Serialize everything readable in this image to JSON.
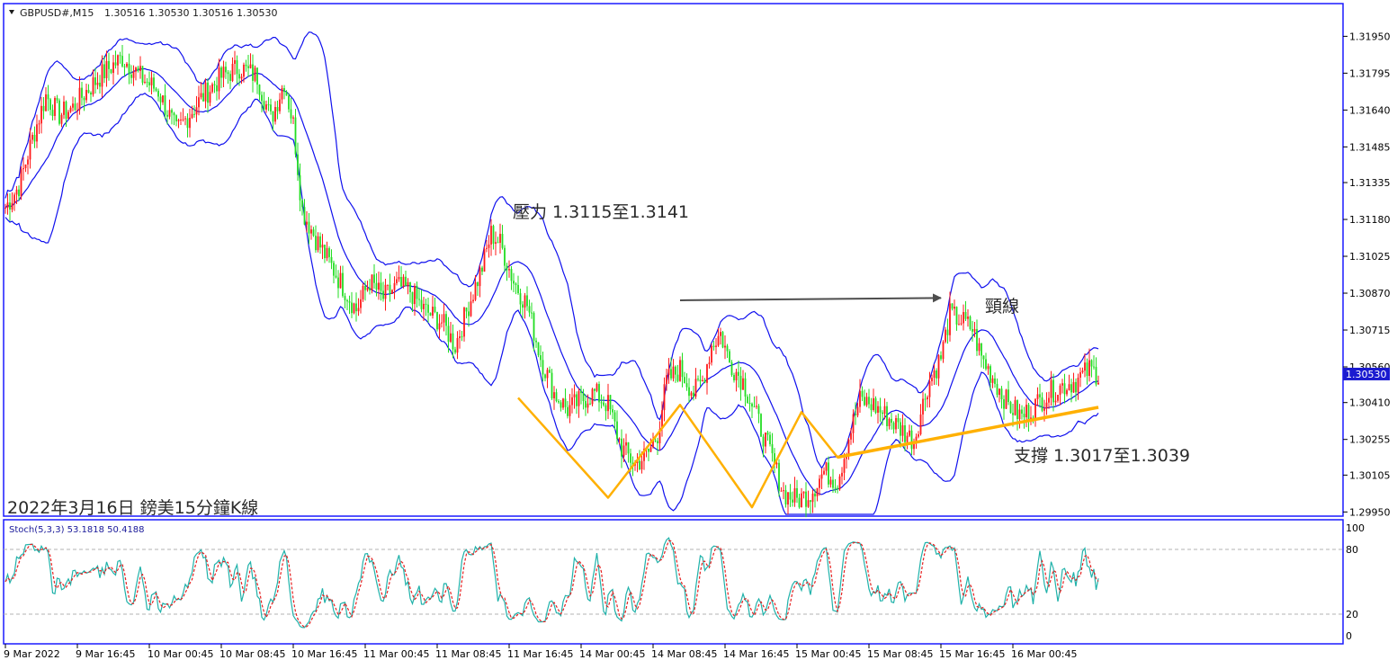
{
  "chart_data": {
    "type": "candlestick",
    "header": {
      "symbol": "GBPUSD#,M15",
      "ohlc": "1.30516 1.30530 1.30516 1.30530"
    },
    "overlay_title": "2022年3月16日 鎊美15分鐘K線",
    "price_axis": {
      "ylim": [
        1.2994,
        1.3208
      ],
      "ticks": [
        "1.31950",
        "1.31795",
        "1.31640",
        "1.31485",
        "1.31335",
        "1.31180",
        "1.31025",
        "1.30870",
        "1.30715",
        "1.30560",
        "1.30410",
        "1.30255",
        "1.30105",
        "1.29950"
      ],
      "tick_values": [
        1.3195,
        1.31795,
        1.3164,
        1.31485,
        1.31335,
        1.3118,
        1.31025,
        1.3087,
        1.30715,
        1.3056,
        1.3041,
        1.30255,
        1.30105,
        1.2995
      ],
      "current_price": "1.30530",
      "current_value": 1.3053
    },
    "time_axis": {
      "labels": [
        "9 Mar 2022",
        "9 Mar 16:45",
        "10 Mar 00:45",
        "10 Mar 08:45",
        "10 Mar 16:45",
        "11 Mar 00:45",
        "11 Mar 08:45",
        "11 Mar 16:45",
        "14 Mar 00:45",
        "14 Mar 08:45",
        "14 Mar 16:45",
        "15 Mar 00:45",
        "15 Mar 08:45",
        "15 Mar 16:45",
        "16 Mar 00:45"
      ],
      "bar_index": [
        0,
        32,
        64,
        96,
        128,
        160,
        192,
        224,
        256,
        288,
        320,
        352,
        384,
        416,
        448
      ]
    },
    "price_path": [
      [
        0,
        1.3123
      ],
      [
        6,
        1.3132
      ],
      [
        12,
        1.3152
      ],
      [
        18,
        1.317
      ],
      [
        24,
        1.3162
      ],
      [
        30,
        1.3165
      ],
      [
        36,
        1.3172
      ],
      [
        44,
        1.318
      ],
      [
        52,
        1.3186
      ],
      [
        60,
        1.3178
      ],
      [
        68,
        1.3172
      ],
      [
        76,
        1.3155
      ],
      [
        80,
        1.316
      ],
      [
        88,
        1.317
      ],
      [
        96,
        1.3178
      ],
      [
        104,
        1.3182
      ],
      [
        112,
        1.3178
      ],
      [
        118,
        1.316
      ],
      [
        124,
        1.3176
      ],
      [
        128,
        1.3158
      ],
      [
        132,
        1.3122
      ],
      [
        138,
        1.311
      ],
      [
        144,
        1.31
      ],
      [
        150,
        1.309
      ],
      [
        156,
        1.308
      ],
      [
        162,
        1.3092
      ],
      [
        168,
        1.3085
      ],
      [
        174,
        1.309
      ],
      [
        180,
        1.3088
      ],
      [
        186,
        1.308
      ],
      [
        194,
        1.3075
      ],
      [
        200,
        1.3065
      ],
      [
        206,
        1.3082
      ],
      [
        212,
        1.3098
      ],
      [
        216,
        1.3112
      ],
      [
        220,
        1.3108
      ],
      [
        226,
        1.3092
      ],
      [
        232,
        1.3082
      ],
      [
        238,
        1.306
      ],
      [
        244,
        1.3045
      ],
      [
        250,
        1.3038
      ],
      [
        256,
        1.3042
      ],
      [
        262,
        1.3045
      ],
      [
        268,
        1.304
      ],
      [
        274,
        1.3022
      ],
      [
        280,
        1.3015
      ],
      [
        286,
        1.302
      ],
      [
        290,
        1.3028
      ],
      [
        294,
        1.305
      ],
      [
        300,
        1.3055
      ],
      [
        306,
        1.3045
      ],
      [
        310,
        1.305
      ],
      [
        314,
        1.3065
      ],
      [
        318,
        1.307
      ],
      [
        322,
        1.3058
      ],
      [
        328,
        1.305
      ],
      [
        334,
        1.3035
      ],
      [
        340,
        1.302
      ],
      [
        346,
        1.3003
      ],
      [
        352,
        1.3
      ],
      [
        358,
        1.3003
      ],
      [
        364,
        1.3012
      ],
      [
        370,
        1.3008
      ],
      [
        376,
        1.303
      ],
      [
        380,
        1.3042
      ],
      [
        386,
        1.304
      ],
      [
        392,
        1.3035
      ],
      [
        398,
        1.303
      ],
      [
        404,
        1.3025
      ],
      [
        410,
        1.3048
      ],
      [
        416,
        1.306
      ],
      [
        420,
        1.3078
      ],
      [
        426,
        1.3075
      ],
      [
        430,
        1.3072
      ],
      [
        434,
        1.306
      ],
      [
        440,
        1.305
      ],
      [
        446,
        1.304
      ],
      [
        452,
        1.3035
      ],
      [
        458,
        1.304
      ],
      [
        464,
        1.3045
      ],
      [
        470,
        1.3048
      ],
      [
        476,
        1.305
      ],
      [
        482,
        1.3055
      ],
      [
        486,
        1.3053
      ]
    ],
    "bollinger_bands": {
      "period": 20,
      "deviations": 2
    },
    "annotations": {
      "resistance_label": "壓力 1.3115至1.3141",
      "neckline_label": "頸線",
      "support_label": "支撐 1.3017至1.3039",
      "pattern_line": [
        [
          228,
          1.3043
        ],
        [
          268,
          1.3001
        ],
        [
          300,
          1.304
        ],
        [
          332,
          1.2997
        ],
        [
          354,
          1.3037
        ],
        [
          370,
          1.3018
        ],
        [
          486,
          1.3039
        ]
      ],
      "support_line": [
        [
          370,
          1.3018
        ],
        [
          486,
          1.3039
        ]
      ],
      "neckline": [
        [
          300,
          1.3084
        ],
        [
          416,
          1.3085
        ]
      ]
    },
    "stochastic": {
      "label": "Stoch(5,3,3) 53.1818 50.4188",
      "k": 53.1818,
      "d": 50.4188,
      "ylim": [
        0,
        100
      ],
      "ticks": [
        "100",
        "80",
        "20",
        "0"
      ],
      "tick_values": [
        100,
        80,
        20,
        0
      ],
      "levels": [
        80,
        20
      ]
    },
    "colors": {
      "up": "#ff1a1a",
      "down": "#22dd22",
      "bands": "#1010ee",
      "pattern": "#ffb000",
      "neckline": "#4d4d4d",
      "stoch_main": "#20b2aa",
      "stoch_signal": "#e52020",
      "frame": "#1a1aff",
      "price_tag": "#1a1ad0"
    }
  }
}
